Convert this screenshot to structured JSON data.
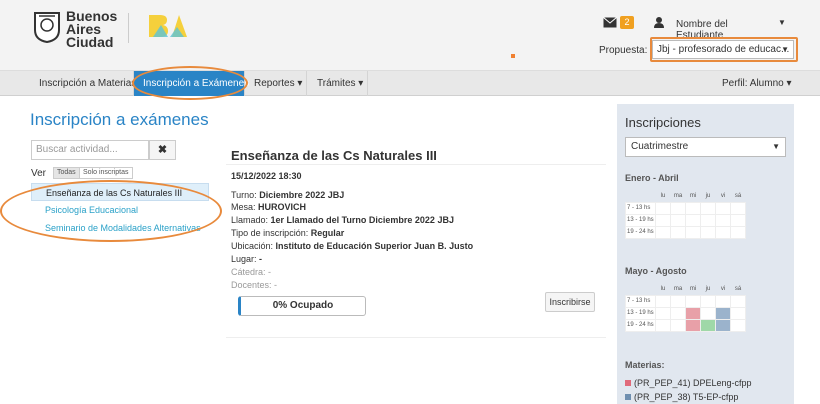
{
  "header": {
    "logo_line1": "Buenos",
    "logo_line2": "Aires",
    "logo_line3": "Ciudad",
    "badge_count": "2",
    "user_name": "Nombre del Estudiante",
    "propuesta_label": "Propuesta:",
    "propuesta_value": "Jbj - profesorado de educac..."
  },
  "nav": {
    "items": [
      "Inscripción a Materias",
      "Inscripción a Exámenes",
      "Reportes ▾",
      "Trámites ▾"
    ],
    "perfil": "Perfil: Alumno ▾"
  },
  "left": {
    "title": "Inscripción a exámenes",
    "search_placeholder": "Buscar actividad...",
    "search_button": "✖",
    "ver_label": "Ver",
    "filter_all": "Todas",
    "filter_mine": "Solo inscriptas",
    "items": [
      "Enseñanza de las Cs Naturales III",
      "Psicología Educacional",
      "Seminario de Modalidades Alternativas"
    ]
  },
  "detail": {
    "title": "Enseñanza de las Cs Naturales III",
    "date": "15/12/2022 18:30",
    "turno_k": "Turno:",
    "turno_v": "Diciembre 2022 JBJ",
    "mesa_k": "Mesa:",
    "mesa_v": "HUROVICH",
    "llamado_k": "Llamado:",
    "llamado_v": "1er Llamado del Turno Diciembre 2022 JBJ",
    "tipo_k": "Tipo de inscripción:",
    "tipo_v": "Regular",
    "ubic_k": "Ubicación:",
    "ubic_v": "Instituto de Educación Superior Juan B. Justo",
    "lugar_k": "Lugar:",
    "lugar_v": "-",
    "catedra_k": "Cátedra:",
    "catedra_v": "-",
    "docentes_k": "Docentes:",
    "docentes_v": "-",
    "progress": "0% Ocupado",
    "progress_value": 0,
    "inscribir": "Inscribirse"
  },
  "right": {
    "title": "Inscripciones",
    "select": "Cuatrimestre",
    "sem1": "Enero - Abril",
    "sem2": "Mayo - Agosto",
    "days": [
      "lu",
      "ma",
      "mi",
      "ju",
      "vi",
      "sá"
    ],
    "rows": [
      "7 - 13 hs",
      "13 - 19 hs",
      "19 - 24 hs"
    ],
    "materias_label": "Materias:",
    "materias": [
      "(PR_PEP_41) DPELeng-cfpp",
      "(PR_PEP_38) T5-EP-cfpp"
    ],
    "colors": {
      "pink": "#e8a0a8",
      "green": "#9fd8a8",
      "blue": "#9bb3cc"
    }
  }
}
